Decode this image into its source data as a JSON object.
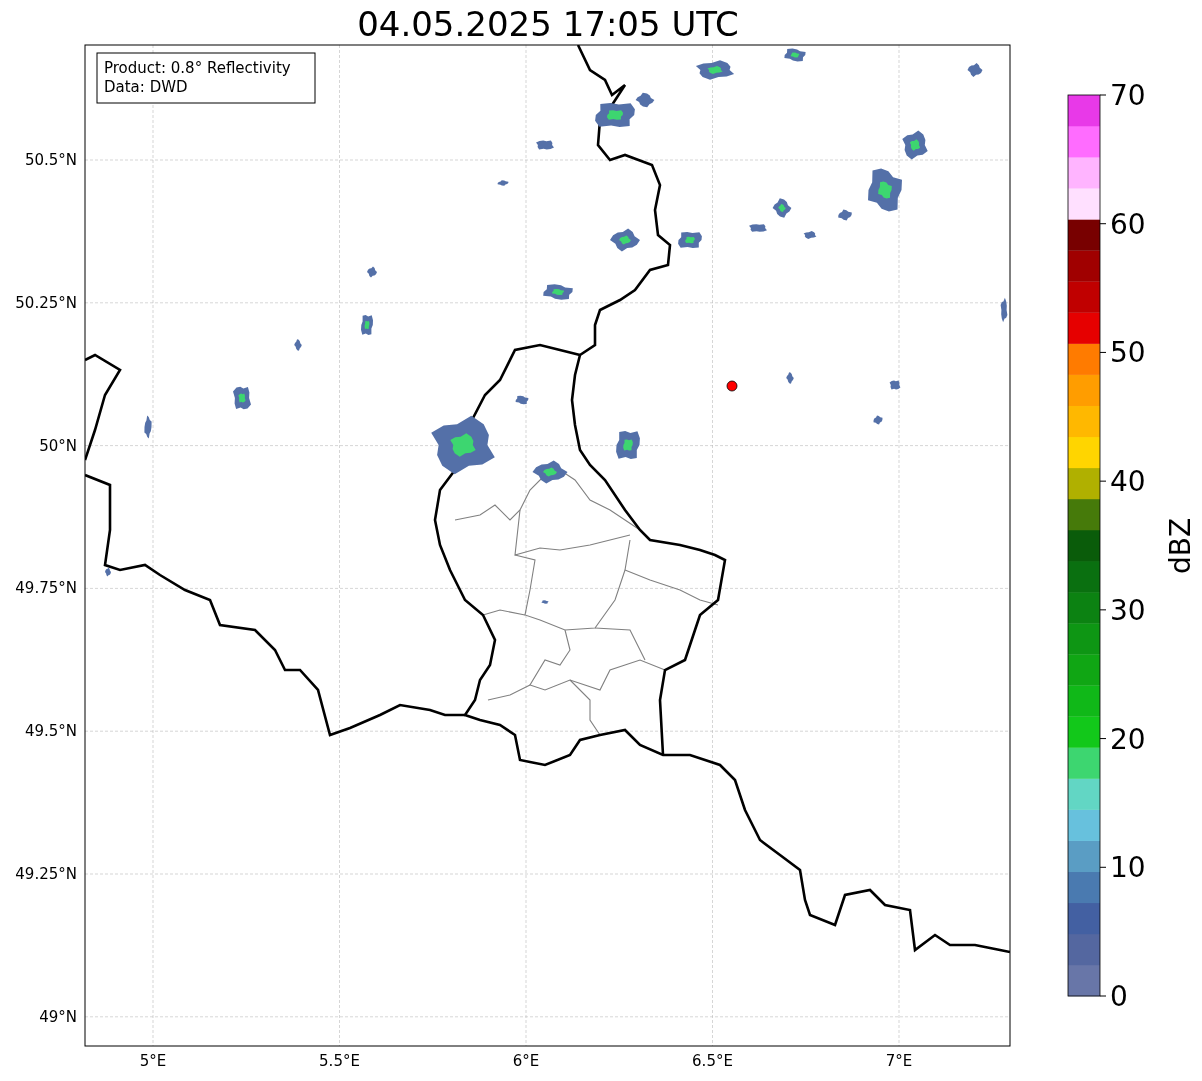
{
  "title": "04.05.2025 17:05 UTC",
  "annotation": {
    "lines": [
      "Product: 0.8° Reflectivity",
      "Data: DWD"
    ]
  },
  "x_tick_labels": [
    "5°E",
    "5.5°E",
    "6°E",
    "6.5°E",
    "7°E"
  ],
  "y_tick_labels": [
    "50.5°N",
    "50.25°N",
    "50°N",
    "49.75°N",
    "49.5°N",
    "49.25°N",
    "49°N"
  ],
  "colorbar": {
    "label": "dBZ",
    "tick_labels": [
      "70",
      "60",
      "50",
      "40",
      "30",
      "20",
      "10",
      "0"
    ],
    "segments": [
      {
        "color": "#6876a8"
      },
      {
        "color": "#5467a0"
      },
      {
        "color": "#4360a2"
      },
      {
        "color": "#4a7ab0"
      },
      {
        "color": "#5a9dc4"
      },
      {
        "color": "#67c1dd"
      },
      {
        "color": "#62d6c4"
      },
      {
        "color": "#3dd670"
      },
      {
        "color": "#12c81a"
      },
      {
        "color": "#10b818"
      },
      {
        "color": "#10a614"
      },
      {
        "color": "#0e9614"
      },
      {
        "color": "#0c8212"
      },
      {
        "color": "#0a7010"
      },
      {
        "color": "#0a5c0a"
      },
      {
        "color": "#467a0a"
      },
      {
        "color": "#b0b000"
      },
      {
        "color": "#ffd500"
      },
      {
        "color": "#ffb800"
      },
      {
        "color": "#ff9d00"
      },
      {
        "color": "#ff7b00"
      },
      {
        "color": "#e60000"
      },
      {
        "color": "#c00000"
      },
      {
        "color": "#a00000"
      },
      {
        "color": "#780000"
      },
      {
        "color": "#ffe0ff"
      },
      {
        "color": "#ffb4ff"
      },
      {
        "color": "#ff6cff"
      },
      {
        "color": "#e839e8"
      }
    ]
  }
}
